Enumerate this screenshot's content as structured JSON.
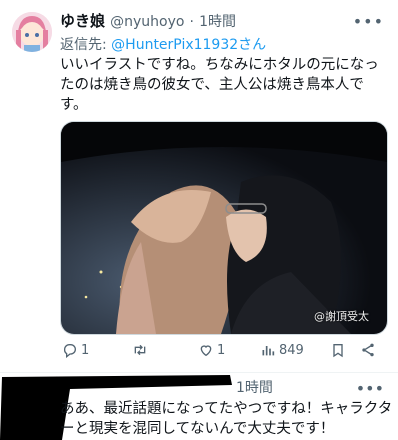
{
  "tweet": {
    "author_name": "ゆき娘",
    "handle": "@nyuhoyo",
    "separator": "·",
    "time": "1時間",
    "reply_to_label": "返信先: ",
    "reply_to_handle": "@HunterPix11932さん",
    "text": "いいイラストですね。ちなみにホタルの元になったのは焼き鳥の彼女で、主人公は焼き鳥本人です。",
    "image_watermark": "@謝頂受太",
    "actions": {
      "replies": "1",
      "retweets": "",
      "likes": "1",
      "views": "849"
    }
  },
  "reply": {
    "time": "1時間",
    "text": "ああ、最近話題になってたやつですね！キャラクターと現実を混同してないんで大丈夫です！"
  }
}
